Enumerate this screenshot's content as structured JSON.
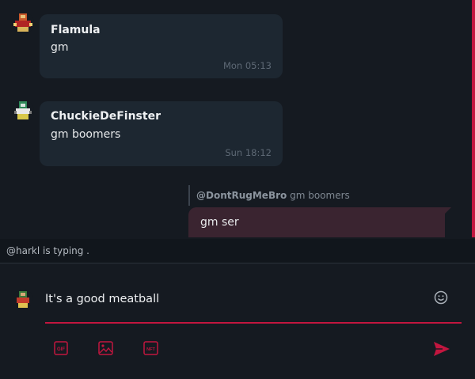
{
  "messages": [
    {
      "author": "Flamula",
      "text": "gm",
      "time": "Mon 05:13",
      "avatar_icon": "pixel-avatar-icon"
    },
    {
      "author": "ChuckieDeFinster",
      "text": "gm boomers",
      "time": "Sun 18:12",
      "avatar_icon": "pixel-avatar-icon"
    }
  ],
  "reply": {
    "quote_author": "@DontRugMeBro",
    "quote_text": "gm boomers",
    "text": "gm ser"
  },
  "typing_indicator": "@harkl is typing .",
  "composer": {
    "value": "It's a good meatball",
    "tools": [
      "GIF",
      "image-icon",
      "NFT"
    ],
    "emoji_icon": "smiley-icon",
    "send_icon": "send-icon"
  },
  "colors": {
    "accent": "#c2163f",
    "background": "#151a21",
    "bubble": "#1d2731",
    "own_bubble": "#3a2430"
  }
}
